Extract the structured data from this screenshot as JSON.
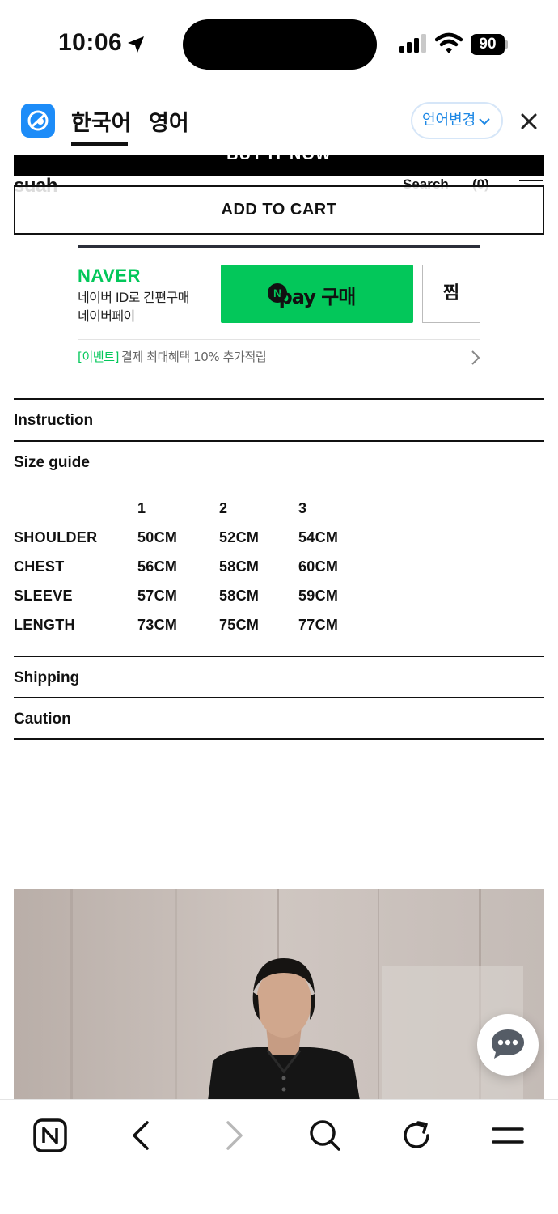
{
  "status_bar": {
    "time": "10:06",
    "battery": "90"
  },
  "translate_bar": {
    "tabs": [
      {
        "label": "한국어",
        "active": true
      },
      {
        "label": "영어",
        "active": false
      }
    ],
    "change_language": "언어변경"
  },
  "page": {
    "buy_now_label": "BUY IT NOW",
    "logo": "suah",
    "nav": {
      "search": "Search",
      "cart": "(0)"
    },
    "add_to_cart": "ADD TO CART",
    "naver": {
      "brand": "NAVER",
      "desc_line1": "네이버 ID로 간편구매",
      "desc_line2": "네이버페이",
      "pay_button": "pay 구매",
      "pay_badge": "N",
      "zzim": "찜",
      "event_tag": "[이벤트]",
      "event_text": "결제 최대혜택 10% 추가적립"
    },
    "sections": {
      "instruction": "Instruction",
      "size_guide": "Size guide",
      "shipping": "Shipping",
      "caution": "Caution"
    },
    "size_table": {
      "headers": [
        "",
        "1",
        "2",
        "3"
      ],
      "rows": [
        [
          "SHOULDER",
          "50CM",
          "52CM",
          "54CM"
        ],
        [
          "CHEST",
          "56CM",
          "58CM",
          "60CM"
        ],
        [
          "SLEEVE",
          "57CM",
          "58CM",
          "59CM"
        ],
        [
          "LENGTH",
          "73CM",
          "75CM",
          "77CM"
        ]
      ]
    }
  },
  "toolbar": {
    "icons": [
      "naver-home-icon",
      "back-icon",
      "forward-icon",
      "search-icon",
      "refresh-icon",
      "menu-icon"
    ]
  },
  "colors": {
    "naver_green": "#03c75a",
    "translate_blue": "#1e88e5",
    "photo_bg": "#c2b8b2"
  }
}
